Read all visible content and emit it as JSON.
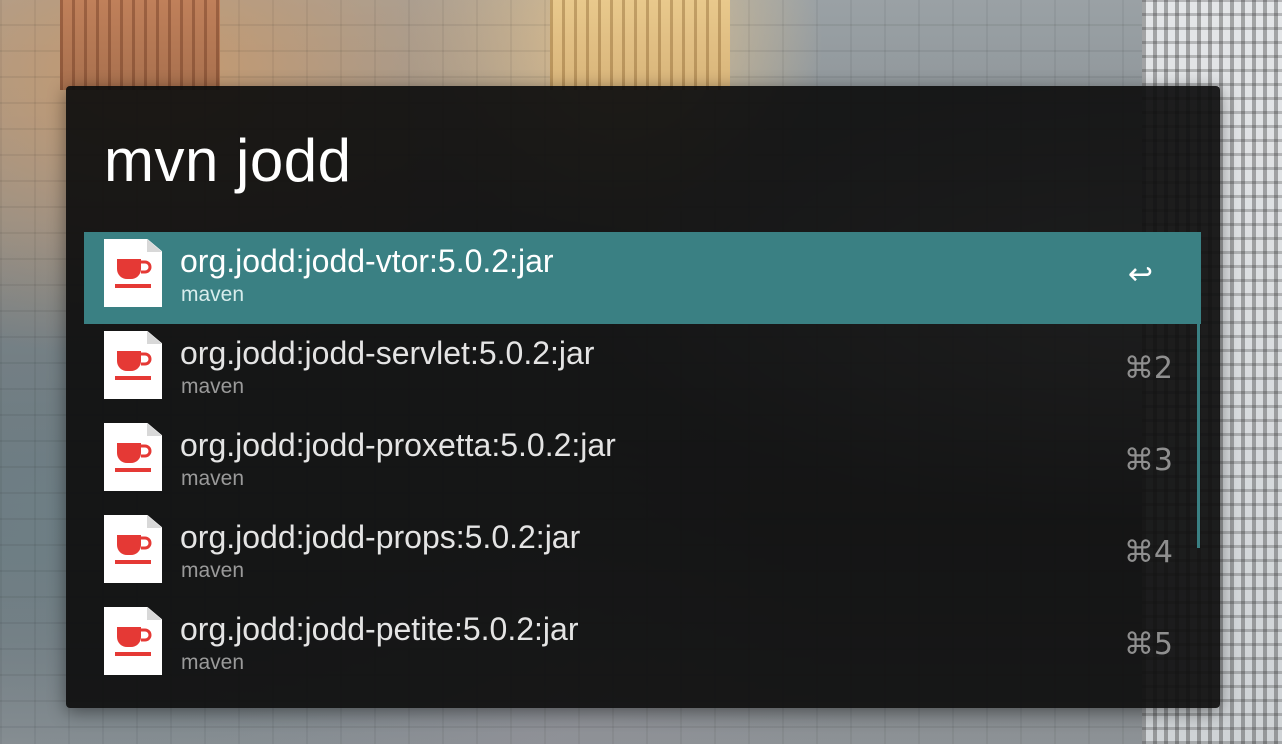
{
  "query": "mvn jodd",
  "results": [
    {
      "title": "org.jodd:jodd-vtor:5.0.2:jar",
      "subtitle": "maven",
      "shortcut": "↩",
      "selected": true,
      "icon": "java-jar-icon"
    },
    {
      "title": "org.jodd:jodd-servlet:5.0.2:jar",
      "subtitle": "maven",
      "shortcut": "⌘2",
      "selected": false,
      "icon": "java-jar-icon"
    },
    {
      "title": "org.jodd:jodd-proxetta:5.0.2:jar",
      "subtitle": "maven",
      "shortcut": "⌘3",
      "selected": false,
      "icon": "java-jar-icon"
    },
    {
      "title": "org.jodd:jodd-props:5.0.2:jar",
      "subtitle": "maven",
      "shortcut": "⌘4",
      "selected": false,
      "icon": "java-jar-icon"
    },
    {
      "title": "org.jodd:jodd-petite:5.0.2:jar",
      "subtitle": "maven",
      "shortcut": "⌘5",
      "selected": false,
      "icon": "java-jar-icon"
    }
  ],
  "colors": {
    "selected_row": "#3a8083",
    "window_bg": "#0e0e0e",
    "icon_red": "#e53935"
  }
}
